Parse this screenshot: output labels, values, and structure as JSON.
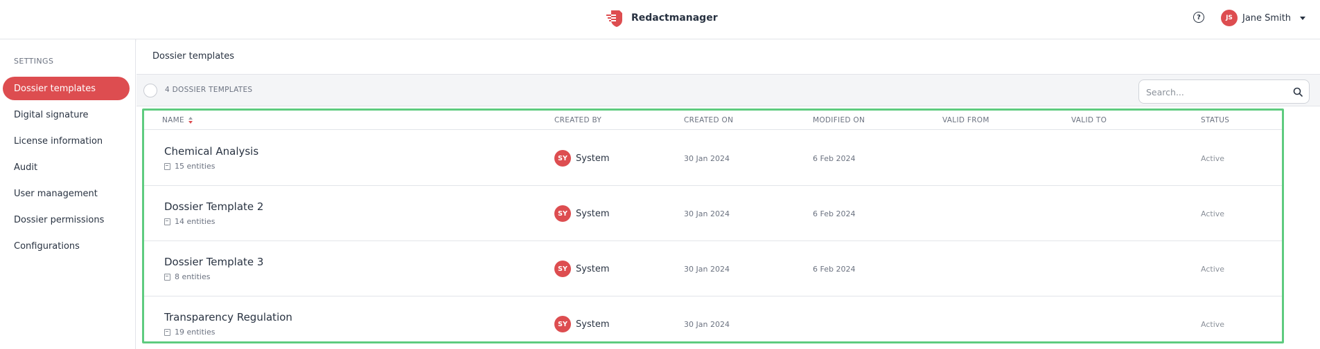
{
  "app": {
    "name": "Redactmanager"
  },
  "header": {
    "help_icon": "help-circle-icon",
    "help_glyph": "?",
    "user": {
      "initials": "JS",
      "name": "Jane Smith"
    }
  },
  "sidebar": {
    "title": "SETTINGS",
    "items": [
      {
        "label": "Dossier templates",
        "active": true
      },
      {
        "label": "Digital signature"
      },
      {
        "label": "License information"
      },
      {
        "label": "Audit"
      },
      {
        "label": "User management"
      },
      {
        "label": "Dossier permissions"
      },
      {
        "label": "Configurations"
      }
    ]
  },
  "main": {
    "breadcrumb": "Dossier templates",
    "count_label": "4 DOSSIER TEMPLATES",
    "search": {
      "placeholder": "Search...",
      "value": ""
    },
    "columns": [
      "NAME",
      "CREATED BY",
      "CREATED ON",
      "MODIFIED ON",
      "VALID FROM",
      "VALID TO",
      "STATUS"
    ],
    "rows": [
      {
        "name": "Chemical Analysis",
        "entities": "15 entities",
        "creator_initials": "SY",
        "creator": "System",
        "created_on": "30 Jan 2024",
        "modified_on": "6 Feb 2024",
        "valid_from": "",
        "valid_to": "",
        "status": "Active"
      },
      {
        "name": "Dossier Template 2",
        "entities": "14 entities",
        "creator_initials": "SY",
        "creator": "System",
        "created_on": "30 Jan 2024",
        "modified_on": "6 Feb 2024",
        "valid_from": "",
        "valid_to": "",
        "status": "Active"
      },
      {
        "name": "Dossier Template 3",
        "entities": "8 entities",
        "creator_initials": "SY",
        "creator": "System",
        "created_on": "30 Jan 2024",
        "modified_on": "6 Feb 2024",
        "valid_from": "",
        "valid_to": "",
        "status": "Active"
      },
      {
        "name": "Transparency Regulation",
        "entities": "19 entities",
        "creator_initials": "SY",
        "creator": "System",
        "created_on": "30 Jan 2024",
        "modified_on": "",
        "valid_from": "",
        "valid_to": "",
        "status": "Active"
      }
    ]
  },
  "colors": {
    "accent": "#dd4d50",
    "highlight": "#5ecb7f"
  }
}
